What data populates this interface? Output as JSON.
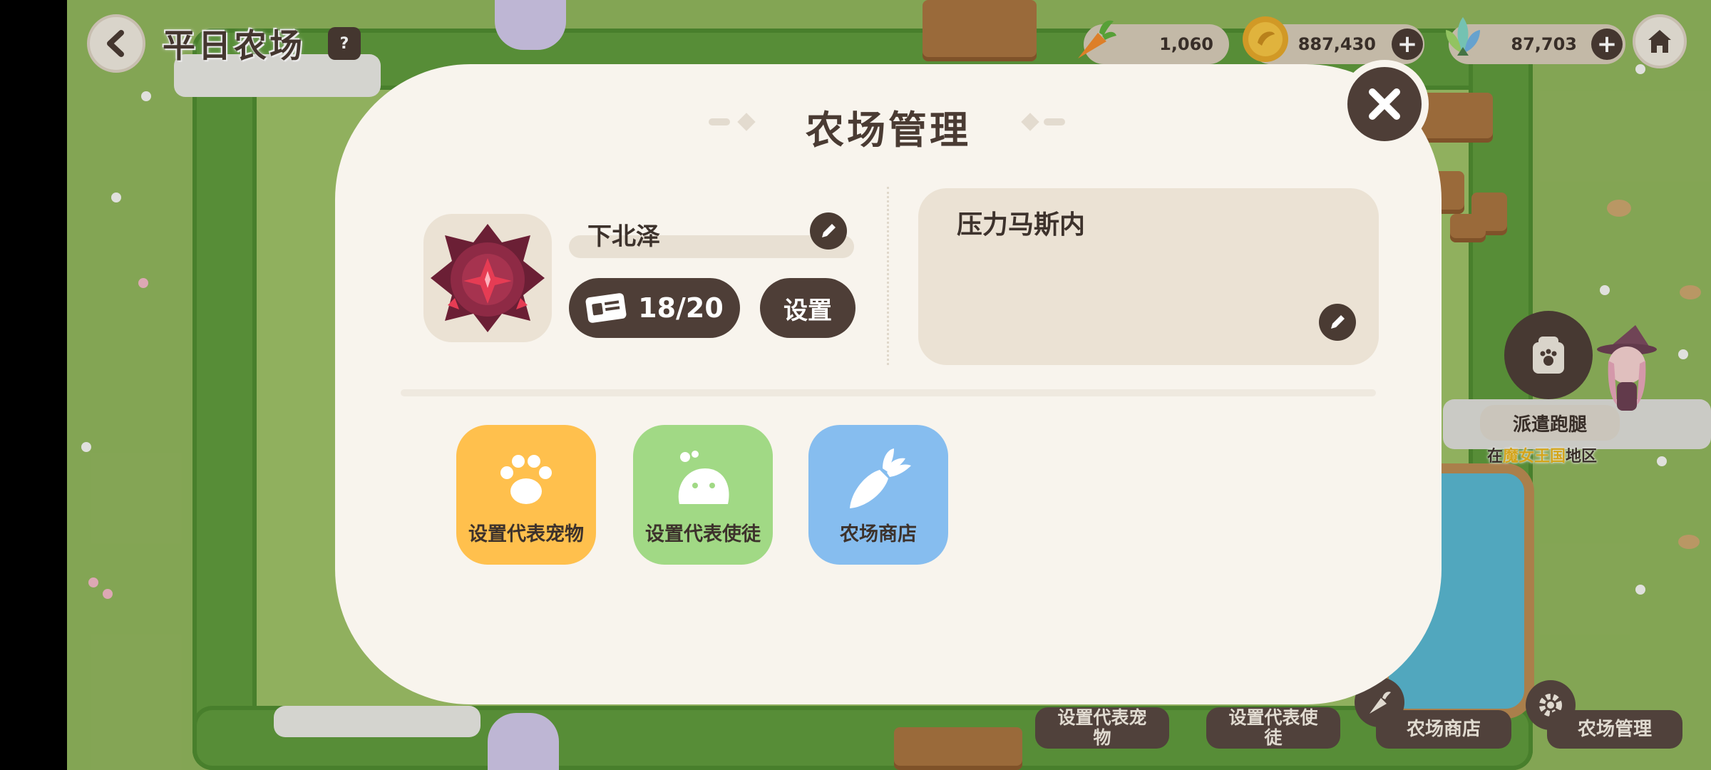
{
  "hud": {
    "farm_title": "平日农场",
    "help_icon": "help-card-icon",
    "resources": [
      {
        "name": "carrot",
        "value": "1,060"
      },
      {
        "name": "coin",
        "value": "887,430"
      },
      {
        "name": "crystal",
        "value": "87,703"
      }
    ]
  },
  "errand": {
    "label": "派遣跑腿",
    "location_prefix": "在",
    "location_name": "魔女王国",
    "location_suffix": "地区"
  },
  "toolbar": [
    {
      "label": "设置代表宠物",
      "icon": "paw-icon"
    },
    {
      "label": "设置代表使徒",
      "icon": "slime-icon"
    },
    {
      "label": "农场商店",
      "icon": "carrot-icon"
    },
    {
      "label": "农场管理",
      "icon": "gear-icon"
    }
  ],
  "modal": {
    "title": "农场管理",
    "profile": {
      "name": "下北泽",
      "card_count": "18/20",
      "settings_label": "设置"
    },
    "signature": "压力马斯内",
    "buttons": [
      {
        "label": "设置代表宠物",
        "color": "#ffc04d",
        "icon": "paw-icon"
      },
      {
        "label": "设置代表使徒",
        "color": "#a1d985",
        "icon": "slime-icon"
      },
      {
        "label": "农场商店",
        "color": "#86bdef",
        "icon": "carrot-icon"
      }
    ]
  },
  "colors": {
    "panel": "#f8f4ed",
    "dark": "#4e3e37",
    "grass": "#8fb35c",
    "hedge": "#5f9a3c"
  }
}
